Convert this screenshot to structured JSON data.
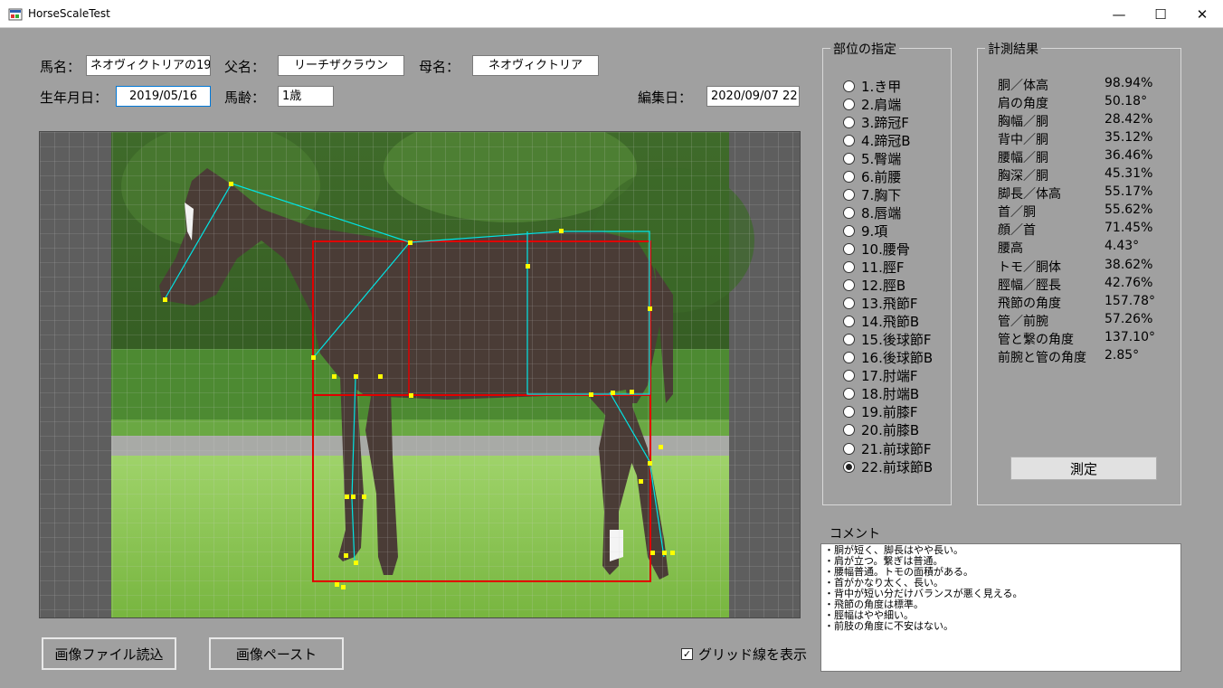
{
  "window": {
    "title": "HorseScaleTest",
    "minimize_glyph": "—",
    "maximize_glyph": "☐",
    "close_glyph": "✕"
  },
  "form": {
    "horse_name_label": "馬名：",
    "horse_name_value": "ネオヴィクトリアの19",
    "sire_label": "父名：",
    "sire_value": "リーチザクラウン",
    "dam_label": "母名：",
    "dam_value": "ネオヴィクトリア",
    "birth_label": "生年月日：",
    "birth_value": "2019/05/16",
    "age_label": "馬齢：",
    "age_value": "1歳",
    "edit_label": "編集日：",
    "edit_value": "2020/09/07 22"
  },
  "parts": {
    "title": "部位の指定",
    "selected_index": 21,
    "items": [
      "1.き甲",
      "2.肩端",
      "3.蹄冠F",
      "4.蹄冠B",
      "5.臀端",
      "6.前腰",
      "7.胸下",
      "8.唇端",
      "9.項",
      "10.腰骨",
      "11.脛F",
      "12.脛B",
      "13.飛節F",
      "14.飛節B",
      "15.後球節F",
      "16.後球節B",
      "17.肘端F",
      "18.肘端B",
      "19.前膝F",
      "20.前膝B",
      "21.前球節F",
      "22.前球節B"
    ]
  },
  "results": {
    "title": "計測結果",
    "rows": [
      {
        "label": "胴／体高",
        "value": "98.94%"
      },
      {
        "label": "肩の角度",
        "value": "50.18°"
      },
      {
        "label": "胸幅／胴",
        "value": "28.42%"
      },
      {
        "label": "背中／胴",
        "value": "35.12%"
      },
      {
        "label": "腰幅／胴",
        "value": "36.46%"
      },
      {
        "label": "胸深／胴",
        "value": "45.31%"
      },
      {
        "label": "脚長／体高",
        "value": "55.17%"
      },
      {
        "label": "首／胴",
        "value": "55.62%"
      },
      {
        "label": "顔／首",
        "value": "71.45%"
      },
      {
        "label": "腰高",
        "value": "4.43°"
      },
      {
        "label": "トモ／胴体",
        "value": "38.62%"
      },
      {
        "label": "脛幅／脛長",
        "value": "42.76%"
      },
      {
        "label": "飛節の角度",
        "value": "157.78°"
      },
      {
        "label": "管／前腕",
        "value": "57.26%"
      },
      {
        "label": "管と繋の角度",
        "value": "137.10°"
      },
      {
        "label": "前腕と管の角度",
        "value": "2.85°"
      }
    ],
    "measure_button": "測定"
  },
  "comment": {
    "label": "コメント",
    "lines": [
      "・胴が短く、脚長はやや長い。",
      "・肩が立つ。繋ぎは普通。",
      "・腰幅普通。トモの面積がある。",
      "・首がかなり太く、長い。",
      "・背中が短い分だけバランスが悪く見える。",
      "・飛節の角度は標準。",
      "・脛幅はやや細い。",
      "・前肢の角度に不安はない。"
    ]
  },
  "actions": {
    "load_image": "画像ファイル読込",
    "paste_image": "画像ペースト",
    "grid_checkbox": "グリッド線を表示",
    "grid_checked": true
  },
  "colors": {
    "background": "#a0a0a0",
    "overlay_line": "#00e5e5",
    "box_red": "#e00000",
    "point_yellow": "#ffff00",
    "grid": "#cfcfcf"
  }
}
